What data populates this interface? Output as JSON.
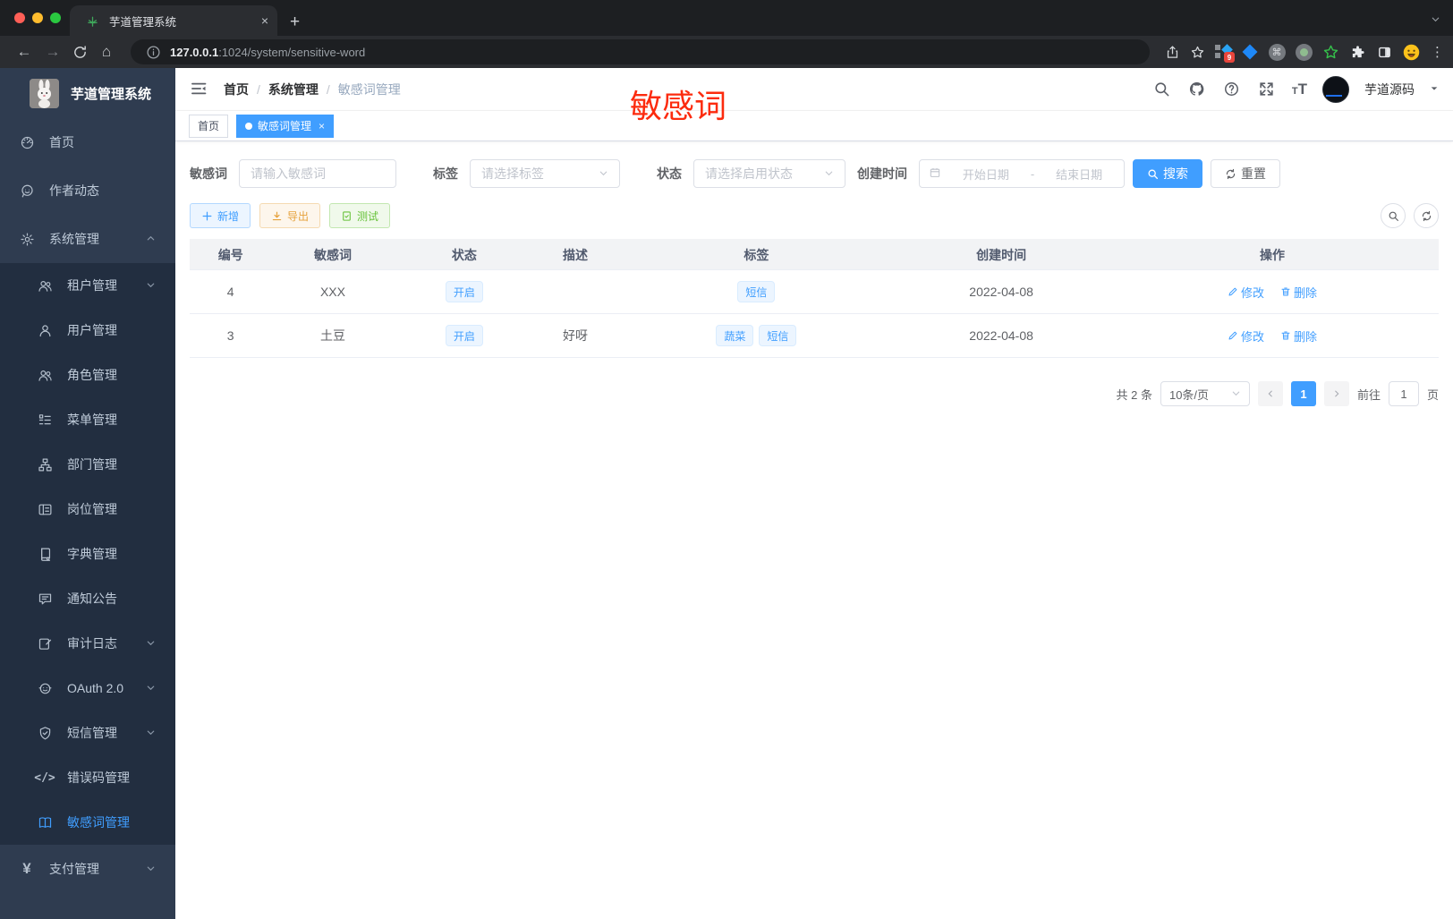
{
  "browser": {
    "tab_title": "芋道管理系统",
    "close_tab": "×",
    "new_tab": "+",
    "url_host": "127.0.0.1",
    "url_rest": ":1024/system/sensitive-word",
    "ext_badge": "9"
  },
  "sidebar": {
    "logo_title": "芋道管理系统",
    "items": [
      {
        "key": "home",
        "icon": "dashboard-icon",
        "label": "首页",
        "level": "root"
      },
      {
        "key": "author-news",
        "icon": "chat-icon",
        "label": "作者动态",
        "level": "root"
      },
      {
        "key": "system",
        "icon": "gear-icon",
        "label": "系统管理",
        "level": "root",
        "arrow": "up"
      },
      {
        "key": "tenant",
        "icon": "users-icon",
        "label": "租户管理",
        "level": "sub",
        "arrow": "down"
      },
      {
        "key": "user",
        "icon": "user-icon",
        "label": "用户管理",
        "level": "sub"
      },
      {
        "key": "role",
        "icon": "users-icon",
        "label": "角色管理",
        "level": "sub"
      },
      {
        "key": "menu",
        "icon": "menu-tree-icon",
        "label": "菜单管理",
        "level": "sub"
      },
      {
        "key": "dept",
        "icon": "org-icon",
        "label": "部门管理",
        "level": "sub"
      },
      {
        "key": "post",
        "icon": "id-card-icon",
        "label": "岗位管理",
        "level": "sub"
      },
      {
        "key": "dict",
        "icon": "books-icon",
        "label": "字典管理",
        "level": "sub"
      },
      {
        "key": "notice",
        "icon": "notice-icon",
        "label": "通知公告",
        "level": "sub"
      },
      {
        "key": "audit-log",
        "icon": "log-icon",
        "label": "审计日志",
        "level": "sub",
        "arrow": "down"
      },
      {
        "key": "oauth2",
        "icon": "robot-icon",
        "label": "OAuth 2.0",
        "level": "sub",
        "arrow": "down"
      },
      {
        "key": "sms",
        "icon": "shield-icon",
        "label": "短信管理",
        "level": "sub",
        "arrow": "down"
      },
      {
        "key": "error-code",
        "icon": "code-icon",
        "label": "错误码管理",
        "level": "sub"
      },
      {
        "key": "sensitive-word",
        "icon": "open-book-icon",
        "label": "敏感词管理",
        "level": "sub",
        "active": true
      },
      {
        "key": "pay",
        "icon": "yen-icon",
        "label": "支付管理",
        "level": "root",
        "arrow": "down"
      }
    ]
  },
  "header": {
    "breadcrumb": [
      "首页",
      "系统管理",
      "敏感词管理"
    ],
    "username": "芋道源码"
  },
  "annotation": {
    "text": "敏感词",
    "color": "#fc2b0e"
  },
  "tags": [
    {
      "label": "首页",
      "active": false
    },
    {
      "label": "敏感词管理",
      "active": true,
      "closable": true
    }
  ],
  "filters": {
    "keyword_label": "敏感词",
    "keyword_placeholder": "请输入敏感词",
    "tag_label": "标签",
    "tag_placeholder": "请选择标签",
    "status_label": "状态",
    "status_placeholder": "请选择启用状态",
    "date_label": "创建时间",
    "date_start": "开始日期",
    "date_separator": "-",
    "date_end": "结束日期",
    "search_label": "搜索",
    "reset_label": "重置"
  },
  "toolbar": {
    "add_label": "新增",
    "export_label": "导出",
    "test_label": "测试"
  },
  "table": {
    "headers": [
      "编号",
      "敏感词",
      "状态",
      "描述",
      "标签",
      "创建时间",
      "操作"
    ],
    "edit_label": "修改",
    "delete_label": "删除",
    "rows": [
      {
        "id": "4",
        "word": "XXX",
        "status": "开启",
        "desc": "",
        "tags": [
          "短信"
        ],
        "created": "2022-04-08"
      },
      {
        "id": "3",
        "word": "土豆",
        "status": "开启",
        "desc": "好呀",
        "tags": [
          "蔬菜",
          "短信"
        ],
        "created": "2022-04-08"
      }
    ]
  },
  "pagination": {
    "total": "共 2 条",
    "page_size": "10条/页",
    "current_page": "1",
    "goto_label": "前往",
    "goto_value": "1",
    "page_unit": "页"
  },
  "colors": {
    "accent": "#409eff",
    "annotation_red": "#fc2b0e",
    "success": "#67c23a",
    "warning": "#e6a23c"
  }
}
